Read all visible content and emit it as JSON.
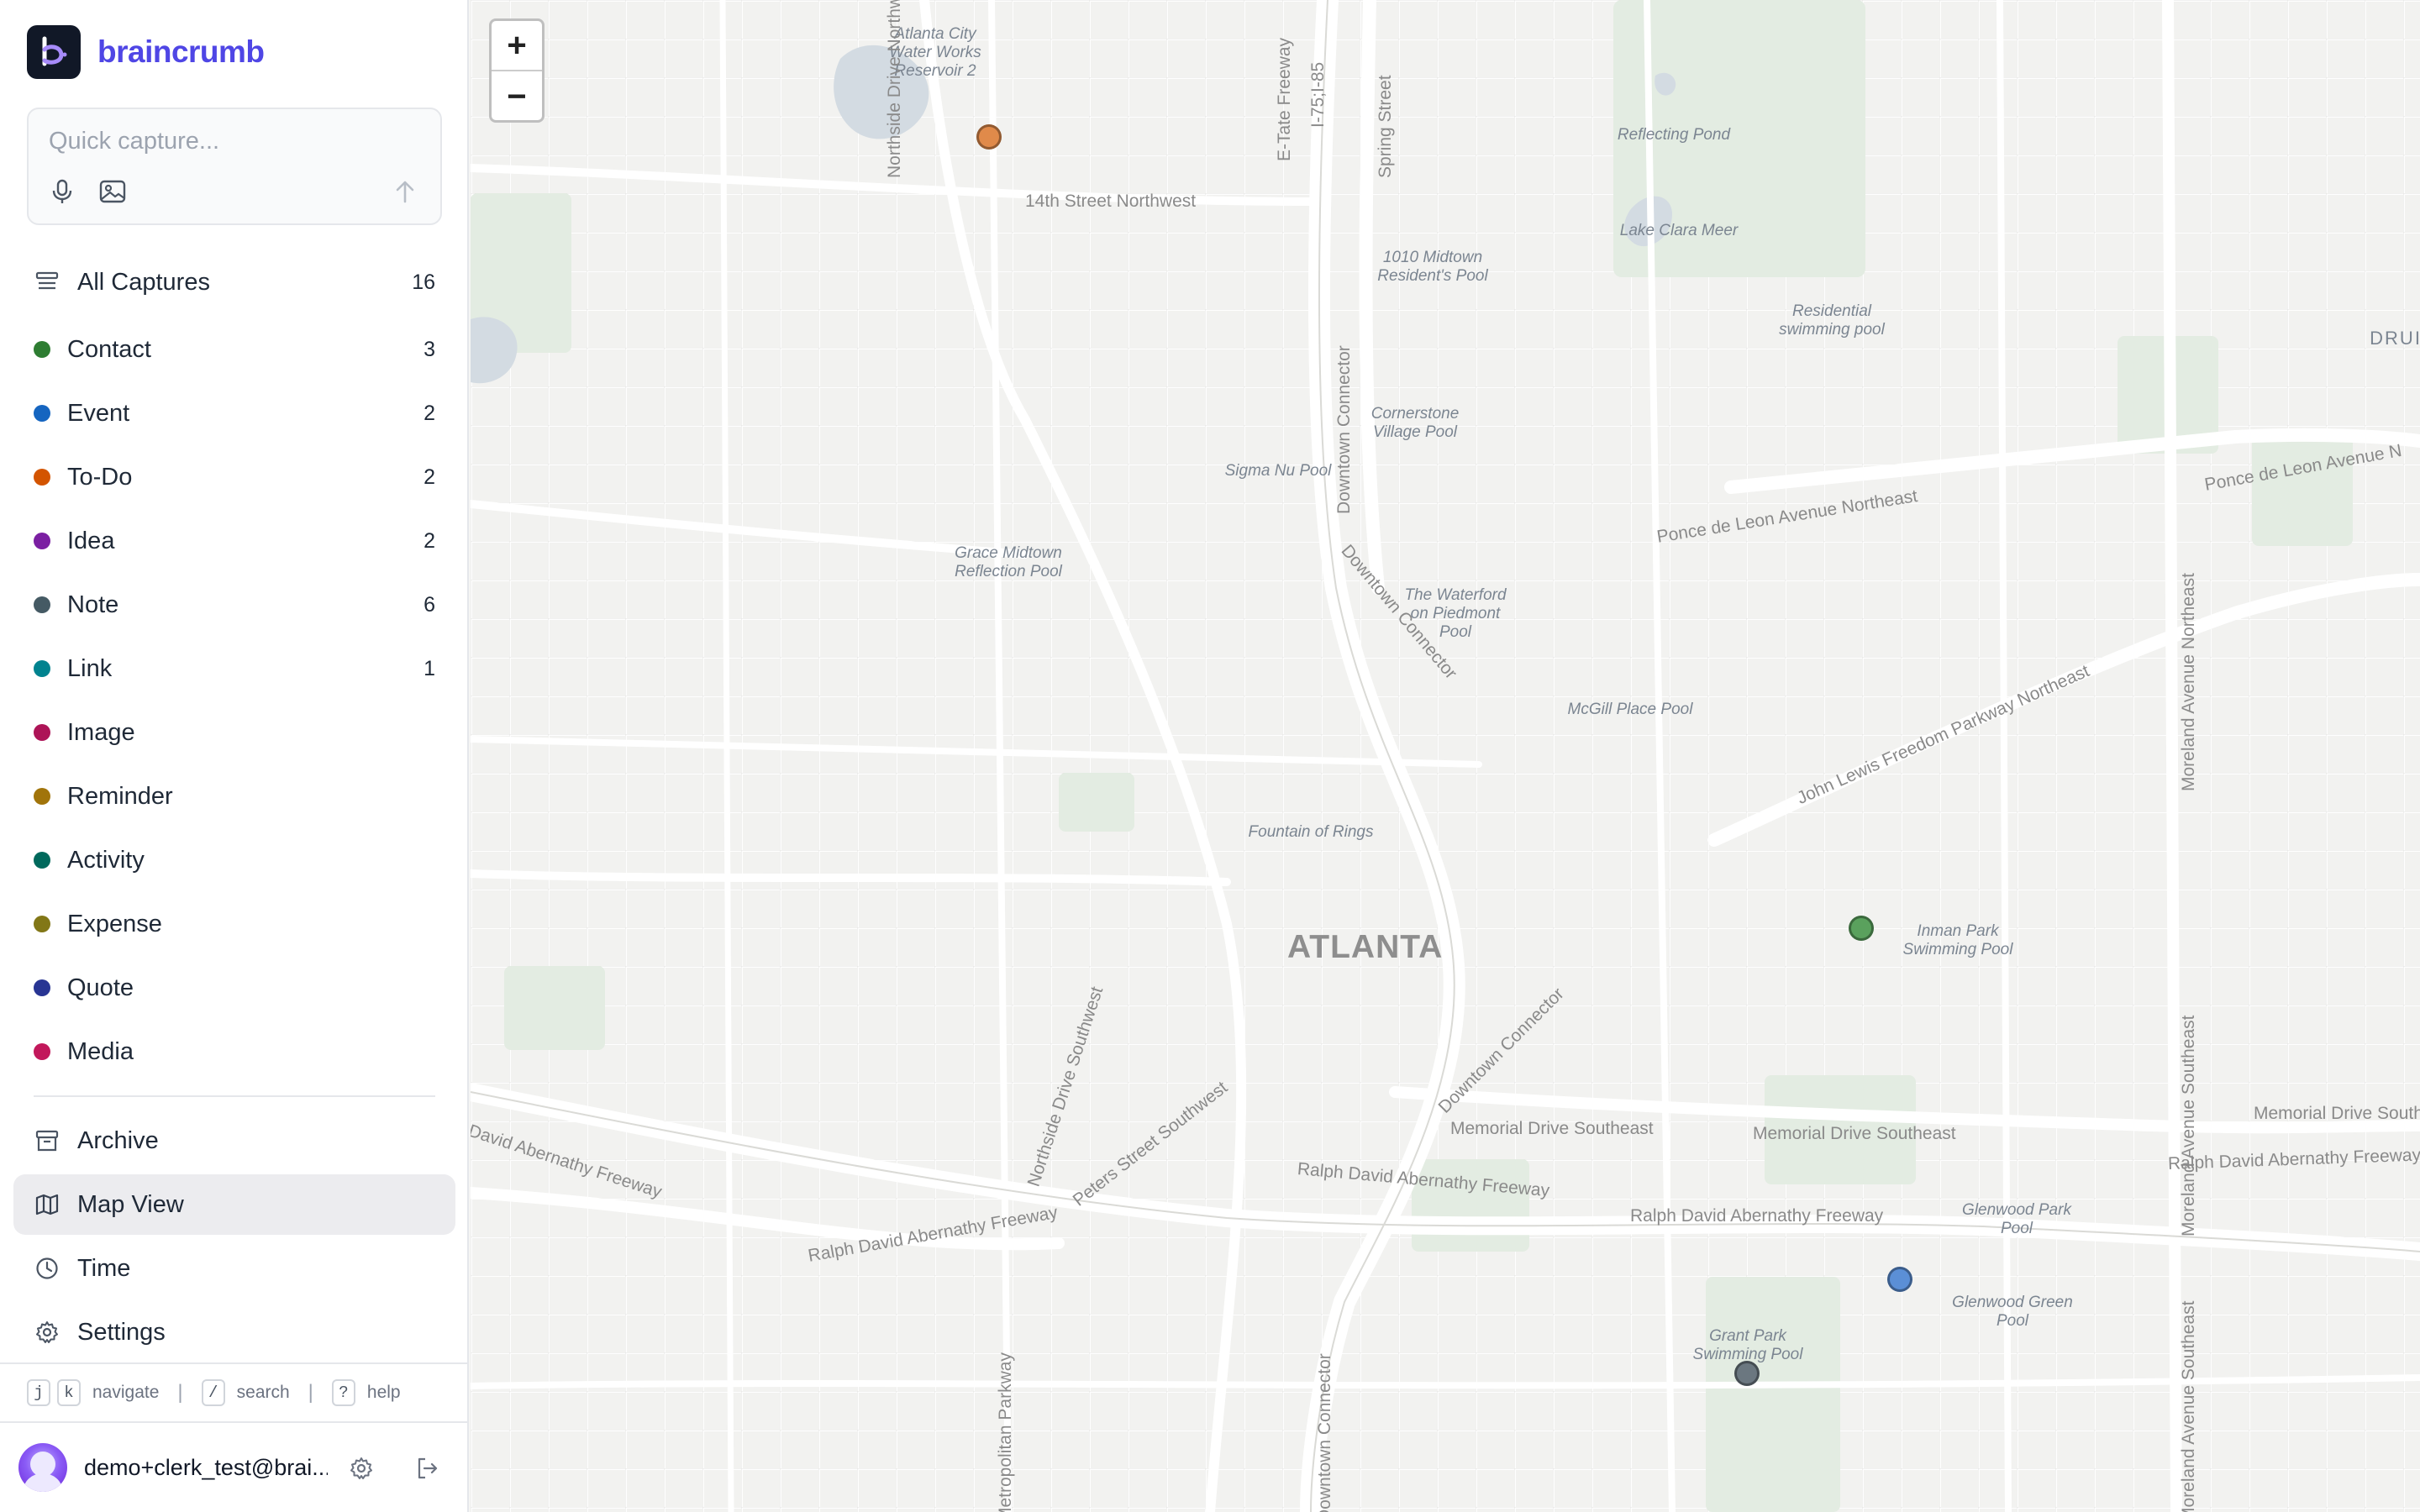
{
  "app": {
    "name": "braincrumb"
  },
  "capture": {
    "placeholder": "Quick capture..."
  },
  "nav": {
    "all_captures": {
      "label": "All Captures",
      "count": "16"
    },
    "archive": "Archive",
    "map_view": "Map View",
    "time": "Time",
    "settings": "Settings"
  },
  "categories": [
    {
      "label": "Contact",
      "count": "3",
      "color": "#2e7d32"
    },
    {
      "label": "Event",
      "count": "2",
      "color": "#1565c0"
    },
    {
      "label": "To-Do",
      "count": "2",
      "color": "#d35400"
    },
    {
      "label": "Idea",
      "count": "2",
      "color": "#7b1fa2"
    },
    {
      "label": "Note",
      "count": "6",
      "color": "#455a64"
    },
    {
      "label": "Link",
      "count": "1",
      "color": "#00838f"
    },
    {
      "label": "Image",
      "count": "",
      "color": "#ad1457"
    },
    {
      "label": "Reminder",
      "count": "",
      "color": "#a1740a"
    },
    {
      "label": "Activity",
      "count": "",
      "color": "#00695c"
    },
    {
      "label": "Expense",
      "count": "",
      "color": "#827717"
    },
    {
      "label": "Quote",
      "count": "",
      "color": "#283593"
    },
    {
      "label": "Media",
      "count": "",
      "color": "#c2185b"
    }
  ],
  "hints": {
    "key_j": "j",
    "key_k": "k",
    "navigate": "navigate",
    "key_slash": "/",
    "search": "search",
    "key_q": "?",
    "help": "help"
  },
  "user": {
    "email": "demo+clerk_test@brai..."
  },
  "map": {
    "zoom_in": "+",
    "zoom_out": "−",
    "city": "ATLANTA",
    "places": {
      "reservoir": "Atlanta City\nWater Works\nReservoir 2",
      "reflecting_pond": "Reflecting Pond",
      "lake_clara_meer": "Lake Clara Meer",
      "midtown_pool": "1010 Midtown\nResident's Pool",
      "residential_pool": "Residential\nswimming pool",
      "cornerstone_pool": "Cornerstone\nVillage Pool",
      "sigma_nu_pool": "Sigma Nu Pool",
      "grace_midtown": "Grace Midtown\nReflection Pool",
      "waterford_pool": "The Waterford\non Piedmont\nPool",
      "mcgill_pool": "McGill Place Pool",
      "fountain_of_rings": "Fountain of Rings",
      "inman_park_pool": "Inman Park\nSwimming Pool",
      "glenwood_park_pool": "Glenwood Park\nPool",
      "glenwood_green_pool": "Glenwood Green\nPool",
      "grant_park_pool": "Grant Park\nSwimming Pool",
      "druid": "DRUID"
    },
    "streets": {
      "fourteenth": "14th Street Northwest",
      "ponce_left": "Ponce de Leon Avenue Northeast",
      "ponce_right": "Ponce de Leon Avenue N",
      "john_lewis": "John Lewis Freedom Parkway Northeast",
      "memorial_1": "Memorial Drive Southeast",
      "memorial_2": "Memorial Drive Southeast",
      "memorial_3": "Memorial Drive Southeast",
      "ralph_1": "Ralph David Abernathy Freeway",
      "ralph_2": "Ralph David Abernathy Freeway",
      "ralph_3": "Ralph David Abernathy Freeway",
      "ralph_4": "Ralph David Abernathy Freeway",
      "ralph_5": "David Abernathy Freeway",
      "downtown_1": "Downtown Connector",
      "downtown_2": "Downtown Connector",
      "downtown_3": "Downtown Connector",
      "downtown_4": "Downtown Connector",
      "spring": "Spring Street",
      "i75": "I-75;I-85",
      "ne_freeway": "E-Tate Freeway",
      "northside_nw": "Northside Drive Northwest",
      "northside_sw": "Northside Drive Southwest",
      "peters": "Peters Street Southwest",
      "moreland_ne": "Moreland Avenue Northeast",
      "moreland_se": "Moreland Avenue Southeast",
      "moreland_se2": "Moreland Avenue Southeast",
      "metropolitan": "Metropolitan Parkway"
    },
    "markers": [
      {
        "category": "To-Do",
        "color": "#e08a4a"
      },
      {
        "category": "Contact",
        "color": "#5aa15d"
      },
      {
        "category": "Event",
        "color": "#5b8fd6"
      },
      {
        "category": "Note",
        "color": "#6b7780"
      }
    ]
  }
}
